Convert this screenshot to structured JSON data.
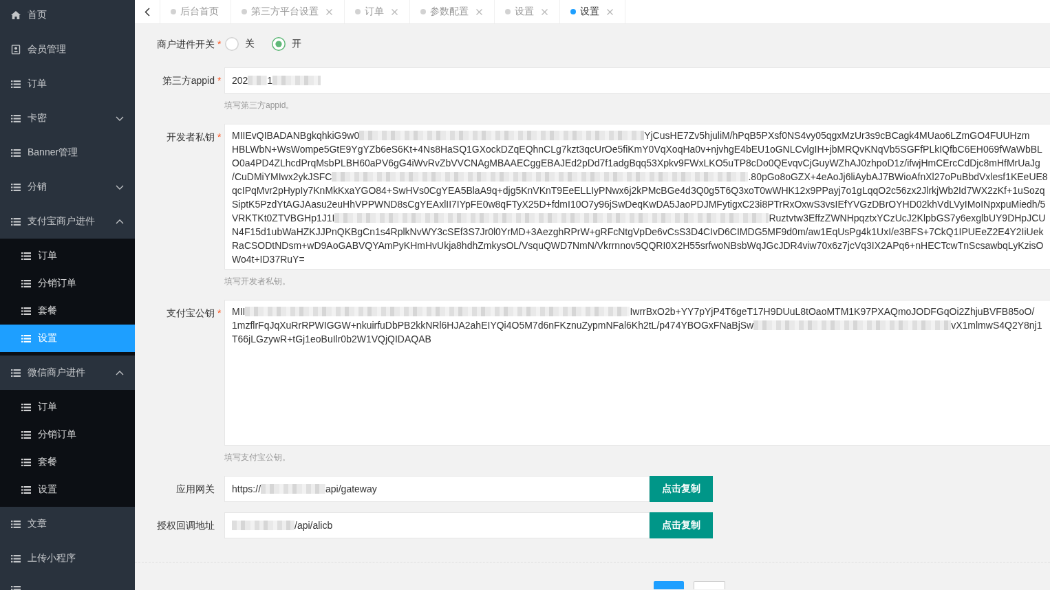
{
  "sidebar": {
    "items": [
      {
        "label": "首页"
      },
      {
        "label": "会员管理"
      },
      {
        "label": "订单"
      },
      {
        "label": "卡密",
        "expanded": false
      },
      {
        "label": "Banner管理"
      },
      {
        "label": "分销",
        "expanded": false
      },
      {
        "label": "支付宝商户进件",
        "expanded": true,
        "children": [
          {
            "label": "订单",
            "selected": false
          },
          {
            "label": "分销订单",
            "selected": false
          },
          {
            "label": "套餐",
            "selected": false
          },
          {
            "label": "设置",
            "selected": true
          }
        ]
      },
      {
        "label": "微信商户进件",
        "expanded": true,
        "children": [
          {
            "label": "订单",
            "selected": false
          },
          {
            "label": "分销订单",
            "selected": false
          },
          {
            "label": "套餐",
            "selected": false
          },
          {
            "label": "设置",
            "selected": false
          }
        ]
      },
      {
        "label": "文章"
      },
      {
        "label": "上传小程序"
      }
    ]
  },
  "tabs": [
    {
      "label": "后台首页",
      "selected": false,
      "closable": false
    },
    {
      "label": "第三方平台设置",
      "selected": false,
      "closable": true
    },
    {
      "label": "订单",
      "selected": false,
      "closable": true
    },
    {
      "label": "参数配置",
      "selected": false,
      "closable": true
    },
    {
      "label": "设置",
      "selected": false,
      "closable": true
    },
    {
      "label": "设置",
      "selected": true,
      "closable": true
    }
  ],
  "form": {
    "fields": [
      {
        "kind": "radio",
        "label": "商户进件开关",
        "mark": "*",
        "options": [
          {
            "label": "关",
            "selected": false
          },
          {
            "label": "开",
            "selected": true
          }
        ]
      },
      {
        "kind": "input",
        "label": "第三方appid",
        "mark": "*",
        "value": [
          {
            "kind": "text",
            "text": "202"
          },
          {
            "kind": "blur"
          },
          {
            "kind": "text",
            "text": "1"
          },
          {
            "kind": "blur"
          }
        ],
        "hint": "填写第三方appid。"
      },
      {
        "kind": "textarea",
        "label": "开发者私钥",
        "mark": "*",
        "lines": [
          [
            {
              "kind": "text",
              "text": "MIIEvQIBADANBgkqhkiG9w0"
            },
            {
              "kind": "blur"
            },
            {
              "kind": "text",
              "text": "YjCusHE7Zv5hjuliM/hPqB5PXsf0NS4vy05qgxMzUr3s9cBCagk4MUao6LZmGO4FUUHzm"
            }
          ],
          [
            {
              "kind": "text",
              "text": "HBLWbN+WsWompe5GtE9YgYZb6eS6Kt+4Ns8HaSQ1GXockDZqEQhnCLg7kzt3qcUrOe5fiKmY0VqXoqHa0v+njvhgE4bEU1oGNLCvlgIH+jbMRQvKNqVb5SGFfPLkIQfbC6EH069fWaWbBL"
            }
          ],
          [
            {
              "kind": "text",
              "text": "O0a4PD4ZLhcdPrqMsbPLBH60aPV6gG4iWvRvZbVVCNAgMBAAECggEBAJEd2pDd7f1adgBqq53Xpkv9FWxLKO5uTP8cDo0QEvqvCjGuyWZhAJ0zhpoD1z/ifwjHmCErcCdDjc8mHfMrUaJg"
            }
          ],
          [
            {
              "kind": "text",
              "text": "/CuDMiYMIwx2ykJSFC"
            },
            {
              "kind": "blur"
            },
            {
              "kind": "text",
              "text": ".80pGo8oGZX+4eAoJj6liAybAJ7BWioAfnXl27oPuBbdVxlesf1KEeUE8"
            }
          ],
          [
            {
              "kind": "text",
              "text": "qcIPqMvr2pHypIy7KnMkKxaYGO84+SwHVs0CgYEA5BlaA9q+djg5KnVKnT9EeELLIyPNwx6j2kPMcBGe4d3Q0g5T6Q3xoT0wWHK12x9PPayj7o1gLqqO2c56zx2JlrkjWb2Id7WX2zKf+1uSozq"
            }
          ],
          [
            {
              "kind": "text",
              "text": "SiptK5PzdYtAGJAasu2euHhVPPWND8sCgYEAxlII7IYpFE0w8qFTyX25D+fdmI10O7y96jSwDeqKwDA5JaoPDJMFytigxC23i8PTrRxOxwS3vsIEfYVGzDBrOYHD02khVdLVyIMoINpxpuMiedh/5"
            }
          ],
          [
            {
              "kind": "text",
              "text": "VRKTKt0ZTVBGHp1J1I"
            },
            {
              "kind": "blur"
            },
            {
              "kind": "text",
              "text": "Ruztvtw3EffzZWNHpqztxYCzUcJ2KlpbGS7y6exglbUY9DHpJCU"
            }
          ],
          [
            {
              "kind": "text",
              "text": "N4F15d1ubWaHZKJJPnQKBgCn1s4RplkNvWY3cSEf3S7Jr0l0YrMD+3AezghRPrW+gRFcNtgVpDe6vCsS3D4CIvD6CIMDG5MF9d0m/aw1EqUsPg4k1UxI/e3BFS+7CkQ1IPUEeZ2E4Y2IiUek"
            }
          ],
          [
            {
              "kind": "text",
              "text": "RaCSODtNDsm+wD9AoGABVQYAmPyKHmHvUkja8hdhZmkysOL/VsquQWD7NmN/Vkrrnnov5QQRI0X2H55srfwoNBsbWqJGcJDR4viw70x6z7jcVq3IX2APq6+nHECTcwTnScsawbqLyKzisO"
            }
          ],
          [
            {
              "kind": "text",
              "text": "Wo4t+ID37RuY="
            }
          ]
        ],
        "hint": "填写开发者私钥。"
      },
      {
        "kind": "textarea",
        "label": "支付宝公钥",
        "mark": "*",
        "lines": [
          [
            {
              "kind": "text",
              "text": "MII"
            },
            {
              "kind": "blur"
            },
            {
              "kind": "text",
              "text": "IwrrBxO2b+YY7pYjP4T6geT17H9DUuL8tOaoMTM1K97PXAQmoJODFGqOi2ZhjuBVFB85oO/"
            }
          ],
          [
            {
              "kind": "text",
              "text": "1mzflrFqJqXuRrRPWIGGW+nkuirfuDbPB2kkNRl6HJA2ahEIYQi4O5M7d6nFKznuZypmNFal6Kh2tL/p474YBOGxFNaBjSw"
            },
            {
              "kind": "blur"
            },
            {
              "kind": "text",
              "text": "vX1mlmwS4Q2Y8nj1"
            }
          ],
          [
            {
              "kind": "text",
              "text": "T66jLGzywR+tGj1eoBuIlr0b2W1VQjQIDAQAB"
            }
          ]
        ],
        "hint": "填写支付宝公钥。"
      },
      {
        "kind": "copy",
        "label": "应用网关",
        "value": [
          {
            "kind": "text",
            "text": "https://"
          },
          {
            "kind": "blur"
          },
          {
            "kind": "text",
            "text": "api/gateway"
          }
        ],
        "button": "点击复制"
      },
      {
        "kind": "copy",
        "label": "授权回调地址",
        "value": [
          {
            "kind": "blur"
          },
          {
            "kind": "text",
            "text": "/api/alicb"
          }
        ],
        "button": "点击复制"
      }
    ]
  }
}
